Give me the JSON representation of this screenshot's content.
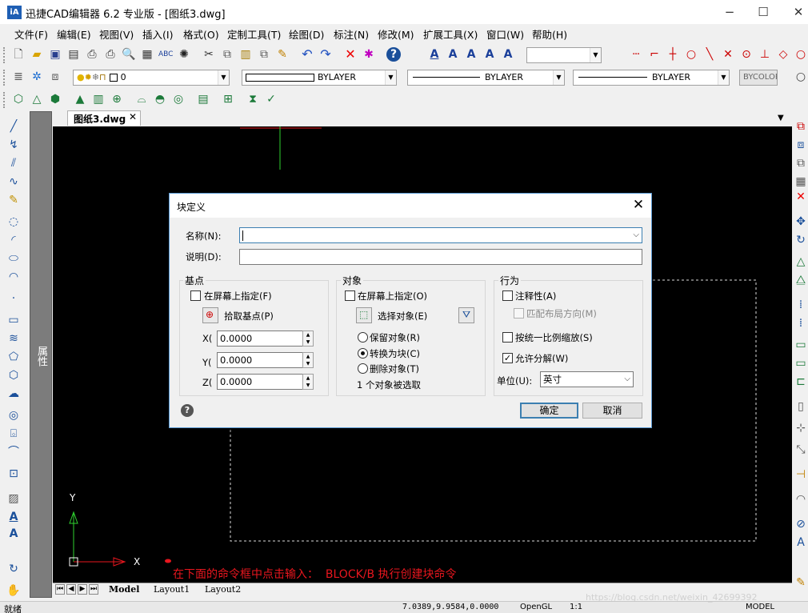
{
  "window": {
    "logo_text": "iA",
    "title": "迅捷CAD编辑器 6.2 专业版  - [图纸3.dwg]",
    "minimize": "−",
    "maximize": "☐",
    "close": "✕"
  },
  "menu": [
    "文件(F)",
    "编辑(E)",
    "视图(V)",
    "插入(I)",
    "格式(O)",
    "定制工具(T)",
    "绘图(D)",
    "标注(N)",
    "修改(M)",
    "扩展工具(X)",
    "窗口(W)",
    "帮助(H)"
  ],
  "layer_toolbar": {
    "layer_value": "0",
    "color_value": "BYLAYER",
    "linetype_value": "BYLAYER",
    "lineweight_value": "BYLAYER",
    "plotstyle_value": "BYCOLOR"
  },
  "document_tab": {
    "label": "图纸3.dwg",
    "close": "✕"
  },
  "properties_panel": {
    "label": "属性"
  },
  "dialog": {
    "title": "块定义",
    "name_label": "名称(N):",
    "name_value": "",
    "description_label": "说明(D):",
    "description_value": "",
    "basepoint": {
      "title": "基点",
      "specify_on_screen": "在屏幕上指定(F)",
      "pick_point": "拾取基点(P)",
      "x_label": "X(",
      "y_label": "Y(",
      "z_label": "Z(",
      "x_value": "0.0000",
      "y_value": "0.0000",
      "z_value": "0.0000"
    },
    "objects": {
      "title": "对象",
      "specify_on_screen": "在屏幕上指定(O)",
      "select_objects": "选择对象(E)",
      "retain": "保留对象(R)",
      "convert": "转换为块(C)",
      "delete": "删除对象(T)",
      "selected_info": "1 个对象被选取",
      "selected_option": "convert"
    },
    "behavior": {
      "title": "行为",
      "annotative": "注释性(A)",
      "match_orientation": "匹配布局方向(M)",
      "scale_uniformly": "按统一比例缩放(S)",
      "allow_exploding": "允许分解(W)",
      "allow_exploding_checked": true,
      "units_label": "单位(U):",
      "units_value": "英寸"
    },
    "ok": "确定",
    "cancel": "取消"
  },
  "canvas": {
    "annotation": "在下面的命令框中点击输入：  BLOCK/B 执行创建块命令",
    "ucs_x": "X",
    "ucs_y": "Y",
    "annotation_color": "#e8161e"
  },
  "layout_tabs": [
    "Model",
    "Layout1",
    "Layout2"
  ],
  "status": {
    "ready": "就绪",
    "coords": "7.0389,9.9584,0.0000",
    "opengl": "OpenGL",
    "scale": "1:1",
    "model": "MODEL",
    "watermark": "https://blog.csdn.net/weixin_42699392"
  }
}
